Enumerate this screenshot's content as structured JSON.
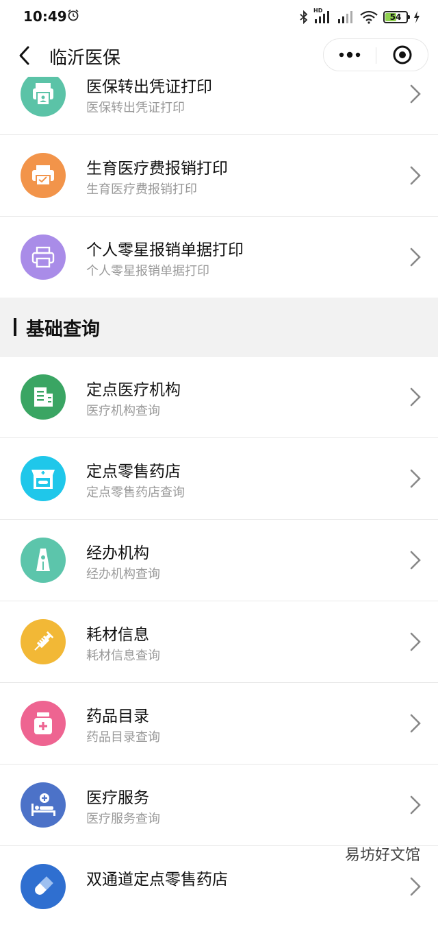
{
  "status_bar": {
    "time": "10:49",
    "network_badge": "HD",
    "battery": "54",
    "battery_level": 0.54
  },
  "nav": {
    "title": "临沂医保"
  },
  "colors": {
    "teal": "#5bc3a7",
    "orange": "#f2944a",
    "purple": "#a98ce8",
    "green": "#3aa563",
    "cyan": "#1fc7ea",
    "mint": "#5cc5ab",
    "yellow": "#f2b836",
    "pink": "#ee6491",
    "blue": "#4c72c8"
  },
  "print_items": [
    {
      "title": "医保转出凭证打印",
      "subtitle": "医保转出凭证打印",
      "icon": "printer-id-icon"
    },
    {
      "title": "生育医疗费报销打印",
      "subtitle": "生育医疗费报销打印",
      "icon": "printer-icon"
    },
    {
      "title": "个人零星报销单据打印",
      "subtitle": "个人零星报销单据打印",
      "icon": "printer-icon"
    }
  ],
  "section": {
    "title": "基础查询"
  },
  "query_items": [
    {
      "title": "定点医疗机构",
      "subtitle": "医疗机构查询",
      "icon": "building-icon"
    },
    {
      "title": "定点零售药店",
      "subtitle": "定点零售药店查询",
      "icon": "pharmacy-icon"
    },
    {
      "title": "经办机构",
      "subtitle": "经办机构查询",
      "icon": "tower-icon"
    },
    {
      "title": "耗材信息",
      "subtitle": "耗材信息查询",
      "icon": "syringe-icon"
    },
    {
      "title": "药品目录",
      "subtitle": "药品目录查询",
      "icon": "medicine-bottle-icon"
    },
    {
      "title": "医疗服务",
      "subtitle": "医疗服务查询",
      "icon": "hospital-bed-icon"
    },
    {
      "title": "双通道定点零售药店",
      "subtitle": "",
      "icon": "capsule-icon"
    }
  ],
  "watermark": "易坊好文馆"
}
